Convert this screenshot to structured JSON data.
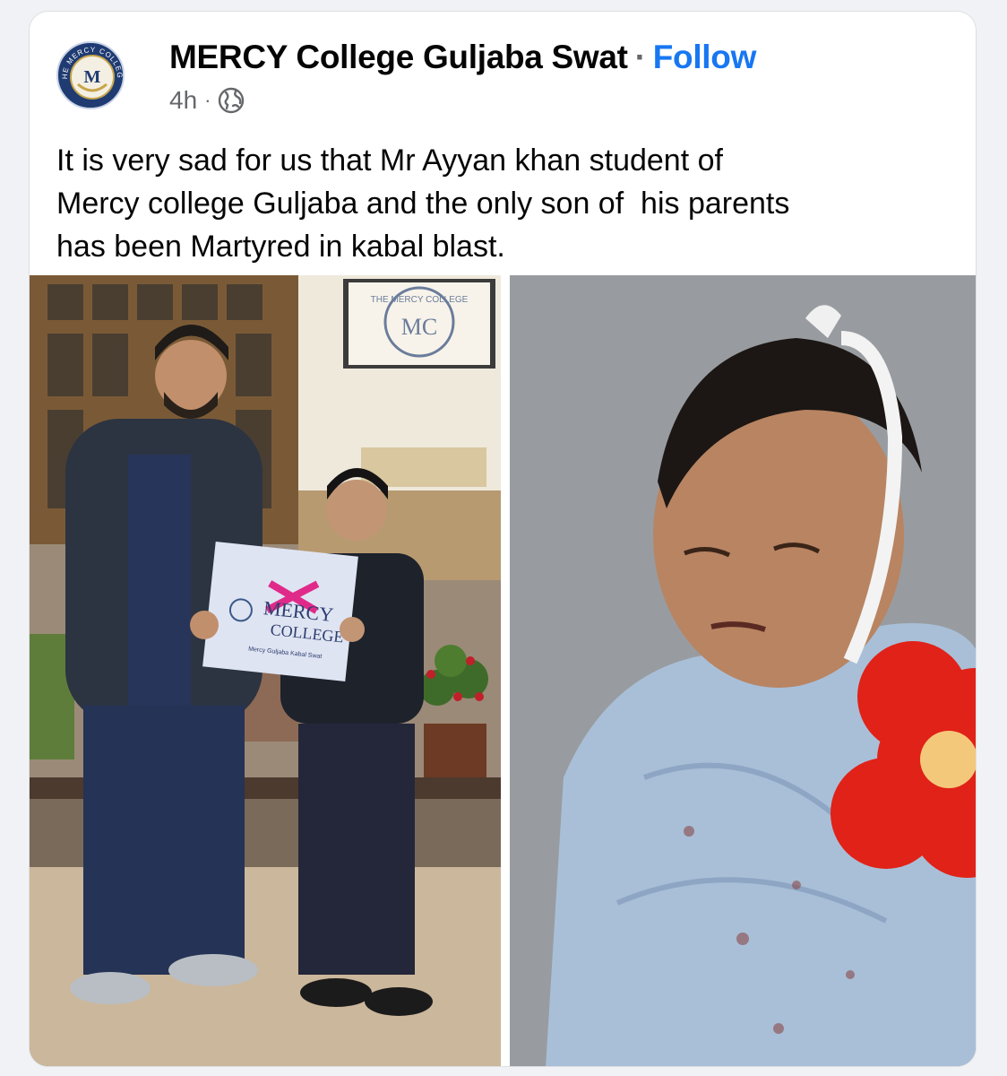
{
  "post": {
    "page_name": "MERCY College Guljaba Swat",
    "separator": "·",
    "follow_label": "Follow",
    "timestamp": "4h",
    "meta_separator": "·",
    "audience_icon": "globe-icon",
    "text_lines": [
      "It is very sad for us that Mr Ayyan khan student of",
      "Mercy college Guljaba and the only son of  his parents",
      "has been Martyred in kabal blast."
    ]
  },
  "avatar": {
    "ring_text": "THE MERCY COLLEGE",
    "monogram": "M"
  },
  "photo_left": {
    "wall_sign_ring_text": "THE MERCY COLLEGE",
    "wall_sign_monogram": "MC",
    "certificate_title_1": "MERCY",
    "certificate_title_2": "COLLEGE",
    "certificate_subtitle": "Mercy Guljaba Kabal Swat"
  },
  "colors": {
    "follow_blue": "#1877f2",
    "text_primary": "#050505",
    "text_secondary": "#65676b",
    "card_bg": "#ffffff"
  }
}
